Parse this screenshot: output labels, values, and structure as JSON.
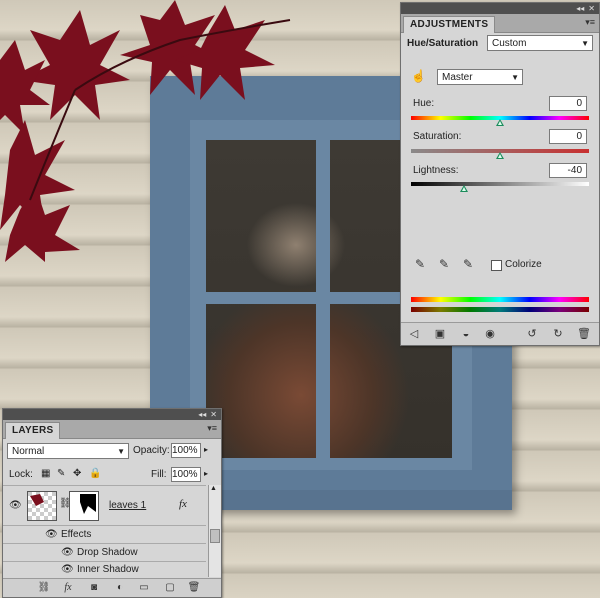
{
  "adjustments": {
    "tab": "ADJUSTMENTS",
    "title": "Hue/Saturation",
    "preset": "Custom",
    "channel": "Master",
    "hue": {
      "label": "Hue:",
      "value": "0",
      "level": 0.5
    },
    "saturation": {
      "label": "Saturation:",
      "value": "0",
      "level": 0.5
    },
    "lightness": {
      "label": "Lightness:",
      "value": "-40",
      "level": 0.3
    },
    "colorize": {
      "label": "Colorize",
      "checked": false
    },
    "icons": [
      "return-icon",
      "layer-clip-icon",
      "visibility-icon",
      "eye-icon",
      "previous-state-icon",
      "reset-icon",
      "trash-icon"
    ]
  },
  "layers": {
    "tab": "LAYERS",
    "blend_mode": "Normal",
    "opacity_label": "Opacity:",
    "opacity": "100%",
    "lock_label": "Lock:",
    "fill_label": "Fill:",
    "fill": "100%",
    "layer_name": "leaves 1",
    "fx": "fx",
    "effects_label": "Effects",
    "effects": [
      "Drop Shadow",
      "Inner Shadow"
    ],
    "bottom_icons": [
      "link-icon",
      "fx-icon",
      "mask-icon",
      "adjustment-icon",
      "folder-icon",
      "new-layer-icon",
      "trash-icon"
    ]
  },
  "colors": {
    "panel_bg": "#d6d6d6",
    "thumb": "#1c8c5c",
    "frame": "#5e7b98"
  }
}
